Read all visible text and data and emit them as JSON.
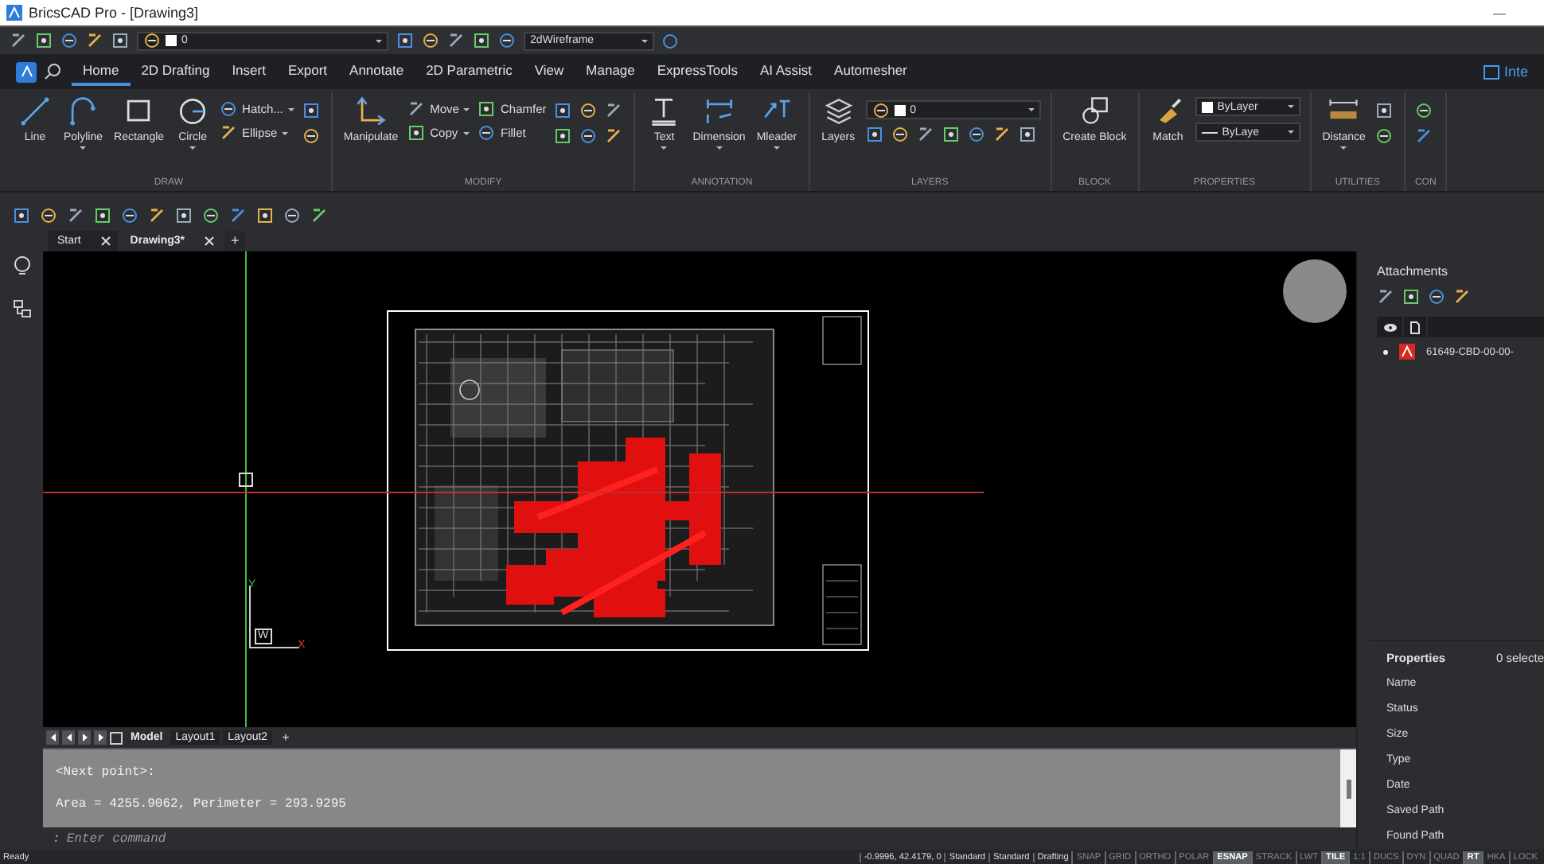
{
  "window": {
    "title": "BricsCAD Pro - [Drawing3]",
    "minimize": "—"
  },
  "quick_access": {
    "layer_combo": "0",
    "visual_style": "2dWireframe"
  },
  "ribbon_tabs": [
    {
      "label": "Home",
      "selected": true
    },
    {
      "label": "2D Drafting",
      "selected": false
    },
    {
      "label": "Insert",
      "selected": false
    },
    {
      "label": "Export",
      "selected": false
    },
    {
      "label": "Annotate",
      "selected": false
    },
    {
      "label": "2D Parametric",
      "selected": false
    },
    {
      "label": "View",
      "selected": false
    },
    {
      "label": "Manage",
      "selected": false
    },
    {
      "label": "ExpressTools",
      "selected": false
    },
    {
      "label": "AI Assist",
      "selected": false
    },
    {
      "label": "Automesher",
      "selected": false
    }
  ],
  "workspace_button": "Inte",
  "ribbon_panels": [
    {
      "title": "DRAW",
      "tools": [
        {
          "kind": "large",
          "label": "Line",
          "menu": false
        },
        {
          "kind": "large",
          "label": "Polyline",
          "menu": true
        },
        {
          "kind": "large",
          "label": "Rectangle",
          "menu": false
        },
        {
          "kind": "large",
          "label": "Circle",
          "menu": true
        },
        {
          "kind": "stack",
          "items": [
            {
              "label": "Hatch...",
              "menu": true
            },
            {
              "label": "Ellipse",
              "menu": true
            }
          ]
        },
        {
          "kind": "icon_pair"
        }
      ]
    },
    {
      "title": "MODIFY",
      "tools": [
        {
          "kind": "large",
          "label": "Manipulate",
          "menu": false
        },
        {
          "kind": "stack",
          "items": [
            {
              "label": "Move",
              "menu": true
            },
            {
              "label": "Copy",
              "menu": true
            }
          ]
        },
        {
          "kind": "stack",
          "items": [
            {
              "label": "Chamfer",
              "menu": false
            },
            {
              "label": "Fillet",
              "menu": false
            }
          ]
        },
        {
          "kind": "icon_grid"
        }
      ]
    },
    {
      "title": "ANNOTATION",
      "tools": [
        {
          "kind": "large",
          "label": "Text",
          "menu": true
        },
        {
          "kind": "large",
          "label": "Dimension",
          "menu": true
        },
        {
          "kind": "large",
          "label": "Mleader",
          "menu": true
        }
      ]
    },
    {
      "title": "LAYERS",
      "tools": [
        {
          "kind": "large",
          "label": "Layers",
          "menu": false
        },
        {
          "kind": "layer_combo",
          "value": "0"
        }
      ]
    },
    {
      "title": "BLOCK",
      "tools": [
        {
          "kind": "large",
          "label": "Create Block",
          "menu": false
        }
      ]
    },
    {
      "title": "PROPERTIES",
      "tools": [
        {
          "kind": "large",
          "label": "Match",
          "menu": false
        },
        {
          "kind": "combos",
          "values": [
            "ByLayer",
            "ByLaye"
          ]
        }
      ]
    },
    {
      "title": "UTILITIES",
      "tools": [
        {
          "kind": "large",
          "label": "Distance",
          "menu": true
        },
        {
          "kind": "icon_pair"
        }
      ]
    },
    {
      "title": "CON",
      "tools": [
        {
          "kind": "icon_pair"
        }
      ]
    }
  ],
  "document_tabs": [
    {
      "label": "Start",
      "selected": false
    },
    {
      "label": "Drawing3*",
      "selected": true
    }
  ],
  "new_tab": "+",
  "viewport": {
    "ucs": {
      "x_label": "X",
      "y_label": "Y",
      "origin_label": "W"
    }
  },
  "layout_tabs": [
    {
      "label": "Model",
      "selected": true
    },
    {
      "label": "Layout1",
      "selected": false
    },
    {
      "label": "Layout2",
      "selected": false
    }
  ],
  "new_layout": "+",
  "command_history": [
    "<Next point>:",
    "Area = 4255.9062, Perimeter = 293.9295"
  ],
  "command_input": {
    "prompt": ":",
    "placeholder": "Enter command"
  },
  "attachments": {
    "title": "Attachments",
    "rows": [
      {
        "name": "61649-CBD-00-00-"
      }
    ]
  },
  "properties": {
    "title": "Properties",
    "selection": "0 selecte",
    "fields": [
      "Name",
      "Status",
      "Size",
      "Type",
      "Date",
      "Saved Path",
      "Found Path"
    ]
  },
  "status_bar": {
    "status": "Ready",
    "coordinates": "-0.9996, 42.4179, 0",
    "fields": [
      "Standard",
      "Standard",
      "Drafting"
    ],
    "toggles": [
      {
        "label": "SNAP",
        "on": false
      },
      {
        "label": "GRID",
        "on": false
      },
      {
        "label": "ORTHO",
        "on": false
      },
      {
        "label": "POLAR",
        "on": false
      },
      {
        "label": "ESNAP",
        "on": true
      },
      {
        "label": "STRACK",
        "on": false
      },
      {
        "label": "LWT",
        "on": false
      },
      {
        "label": "TILE",
        "on": true
      },
      {
        "label": "1:1",
        "on": false
      },
      {
        "label": "DUCS",
        "on": false
      },
      {
        "label": "DYN",
        "on": false
      },
      {
        "label": "QUAD",
        "on": false
      },
      {
        "label": "RT",
        "on": true
      },
      {
        "label": "HKA",
        "on": false
      },
      {
        "label": "LOCK",
        "on": false
      }
    ]
  }
}
